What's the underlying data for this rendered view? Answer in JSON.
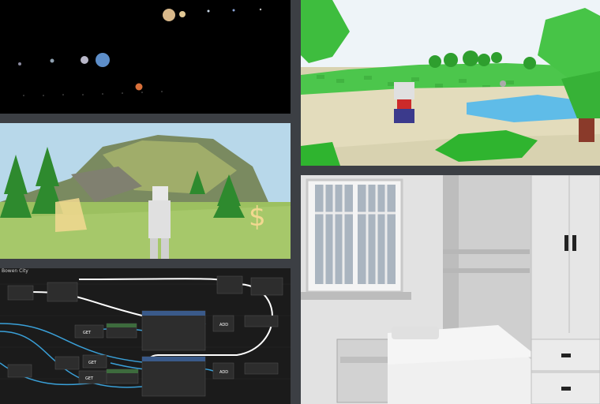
{
  "graph": {
    "tab_title": "Bowen City",
    "nodes": {
      "get": "GET",
      "add": "ADD"
    }
  },
  "colors": {
    "space_bg": "#000000",
    "sky": "#e8f2f7",
    "grass": "#3fbf3f",
    "water": "#5cb8e6",
    "graph_bg": "#1a1a1a",
    "wire_blue": "#3aa0d8",
    "wire_white": "#ffffff",
    "room_gray": "#d9d9d9"
  },
  "icons": [
    "sun-icon",
    "planet-icon"
  ]
}
